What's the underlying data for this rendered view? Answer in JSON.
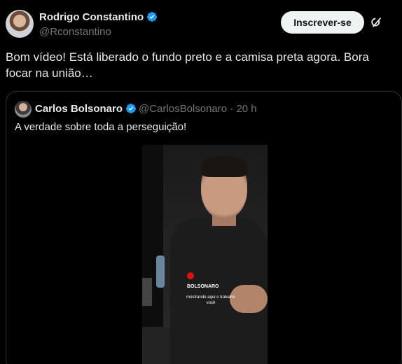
{
  "author": {
    "name": "Rodrigo Constantino",
    "handle": "@Rconstantino"
  },
  "subscribe_label": "Inscrever-se",
  "tweet": {
    "text": "Bom vídeo! Está liberado o fundo preto e a camisa preta agora. Bora focar na união…"
  },
  "quote": {
    "name": "Carlos Bolsonaro",
    "handle_time": "@CarlosBolsonaro · 20 h",
    "text": "A verdade sobre toda a perseguição!",
    "video": {
      "logo_text": "BOLSONARO",
      "caption": "mostrando aqui o trabalho você"
    }
  },
  "colors": {
    "background": "#000000",
    "verified": "#1d9bf0",
    "muted": "#71767b",
    "border": "#2f3336"
  }
}
